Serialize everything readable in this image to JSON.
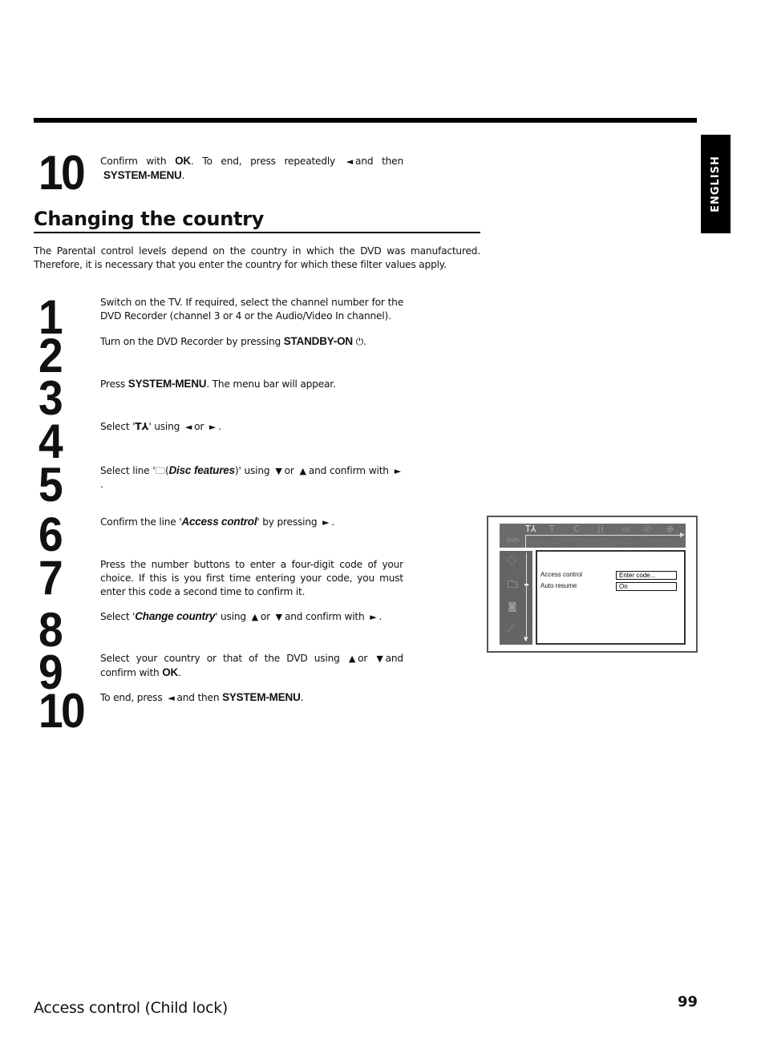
{
  "header": {
    "language_tab": "ENGLISH"
  },
  "previous_step": {
    "number": "10",
    "parts": [
      "Confirm with",
      "OK",
      ". To end, press repeatedly",
      "◄",
      "and then",
      "SYSTEM-MENU",
      "."
    ]
  },
  "section": {
    "title": "Changing the country",
    "intro_line1": "The Parental control levels depend on the country in which the DVD was manufactured.",
    "intro_line2": "Therefore, it is necessary that you enter the country for which these filter values apply."
  },
  "steps": [
    {
      "number": "1",
      "text": "Switch on the TV. If required, select the channel number for the DVD Recorder (channel 3 or 4 or the Audio/Video In channel)."
    },
    {
      "number": "2",
      "pre": "Turn on the DVD Recorder by pressing",
      "key": "STANDBY-ON",
      "icon": "⏻",
      "post": "."
    },
    {
      "number": "3",
      "pre": "Press",
      "key": "SYSTEM-MENU",
      "post": ". The menu bar will appear."
    },
    {
      "number": "4",
      "pre": "Select '",
      "icon": "T⅄",
      "mid": "' using",
      "arrow1": "◄",
      "or": "or",
      "arrow2": "►",
      "post": "."
    },
    {
      "number": "5",
      "pre": "Select line '",
      "icon": "🗀",
      "term": "Disc features",
      "mid": ")' using",
      "arrow1": "▼",
      "or": "or",
      "arrow2": "▲",
      "post": "and confirm with",
      "arrow3": "►",
      "end": "."
    },
    {
      "number": "6",
      "pre": "Confirm the line '",
      "term": "Access control",
      "mid": "' by pressing",
      "arrow1": "►",
      "post": "."
    },
    {
      "number": "7",
      "text": "Press the number buttons to enter a four-digit code of your choice. If this is you first time entering your code, you must enter this code a second time to confirm it."
    },
    {
      "number": "8",
      "pre": "Select '",
      "term": "Change country",
      "mid": "' using",
      "arrow1": "▲",
      "or": "or",
      "arrow2": "▼",
      "post": "and confirm with",
      "arrow3": "►",
      "end": "."
    },
    {
      "number": "9",
      "pre": "Select your country or that of the DVD using",
      "arrow1": "▲",
      "or": "or",
      "arrow2": "▼",
      "mid": "and confirm with",
      "key": "OK",
      "post": "."
    },
    {
      "number": "10",
      "pre": "To end, press",
      "arrow1": "◄",
      "mid": "and then",
      "key": "SYSTEM-MENU",
      "post": "."
    }
  ],
  "screen": {
    "menubar_icons": [
      "settings-tools-icon",
      "title-icon",
      "chapter-icon",
      "audio-icon",
      "subtitle-icon",
      "camera-angle-icon",
      "zoom-icon"
    ],
    "menubar_glyphs": [
      "T⅄",
      "T",
      "C",
      "((",
      "▭",
      "⎚",
      "⊕"
    ],
    "dvd_logo": "DVD",
    "sidebar_glyphs": [
      "◌",
      "🗀",
      "◙",
      "⟋"
    ],
    "rows": [
      {
        "label": "Access control",
        "value": "Enter code..."
      },
      {
        "label": "Auto resume",
        "value": "On"
      }
    ]
  },
  "footer": {
    "section_title": "Access control (Child lock)",
    "page_number": "99"
  }
}
